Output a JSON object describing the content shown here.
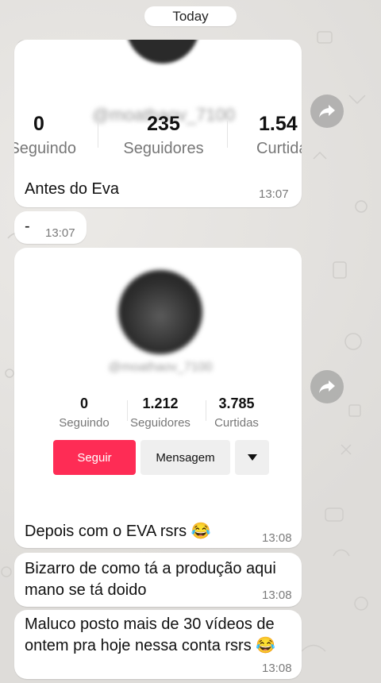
{
  "date_divider": "Today",
  "messages": [
    {
      "profile": {
        "username": "@moathaov_7100",
        "stats": [
          {
            "value": "0",
            "label": "Seguindo"
          },
          {
            "value": "235",
            "label": "Seguidores"
          },
          {
            "value": "1.54",
            "label": "Curtidas"
          }
        ]
      },
      "caption": "Antes do Eva",
      "time": "13:07"
    },
    {
      "text": "-",
      "time": "13:07"
    },
    {
      "profile": {
        "username": "@moathaov_7100",
        "stats": [
          {
            "value": "0",
            "label": "Seguindo"
          },
          {
            "value": "1.212",
            "label": "Seguidores"
          },
          {
            "value": "3.785",
            "label": "Curtidas"
          }
        ],
        "follow_label": "Seguir",
        "message_label": "Mensagem"
      },
      "caption": "Depois com o EVA rsrs 😂",
      "time": "13:08"
    },
    {
      "text": "Bizarro de como tá a produção aqui mano se tá doido",
      "time": "13:08"
    },
    {
      "text": "Maluco posto mais de 30 vídeos de ontem pra hoje nessa conta rsrs 😂",
      "time": "13:08"
    }
  ],
  "colors": {
    "follow_button": "#fe2c55",
    "message_button": "#efefef",
    "forward_button": "#8c8c8c"
  },
  "icons": [
    "forward-icon",
    "dropdown-arrow-icon"
  ]
}
